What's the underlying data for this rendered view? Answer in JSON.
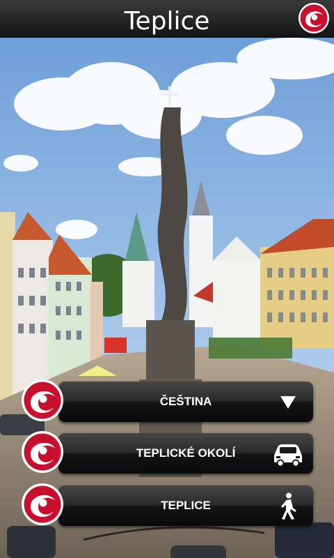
{
  "header": {
    "title": "Teplice",
    "logo_icon": "teplice-logo-icon"
  },
  "menu": [
    {
      "label": "ČEŠTINA",
      "icon": "dropdown-triangle-icon"
    },
    {
      "label": "TEPLICKÉ OKOLÍ",
      "icon": "car-icon"
    },
    {
      "label": "TEPLICE",
      "icon": "walking-person-icon"
    }
  ],
  "colors": {
    "brand_red": "#c8102e",
    "bar_dark": "#141414"
  }
}
